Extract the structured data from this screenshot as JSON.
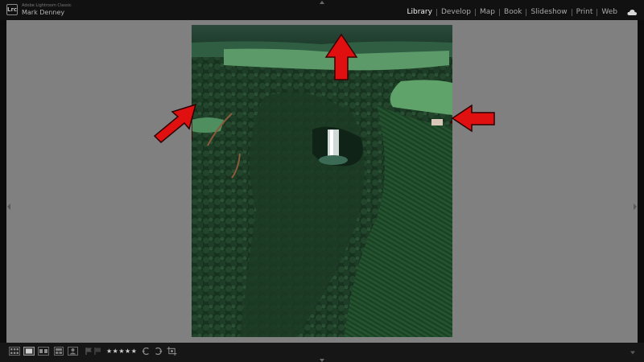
{
  "app": {
    "logo_text": "Lrc",
    "product_name": "Adobe Lightroom Classic",
    "user_name": "Mark Denney"
  },
  "modules": [
    {
      "label": "Library",
      "active": true
    },
    {
      "label": "Develop",
      "active": false
    },
    {
      "label": "Map",
      "active": false
    },
    {
      "label": "Book",
      "active": false
    },
    {
      "label": "Slideshow",
      "active": false
    },
    {
      "label": "Print",
      "active": false
    },
    {
      "label": "Web",
      "active": false
    }
  ],
  "toolbar": {
    "rating_stars": "★★★★★"
  },
  "icons": {
    "grid_view": "grid-view-icon",
    "loupe_view": "loupe-view-icon",
    "compare_view": "compare-view-icon",
    "survey_view": "survey-view-icon",
    "people_view": "people-view-icon",
    "flag": "flag-icon",
    "rotate_left": "rotate-left-icon",
    "rotate_right": "rotate-right-icon",
    "crop_overlay": "crop-overlay-icon",
    "cloud": "cloud-icon"
  },
  "colors": {
    "canvas_bg": "#808080",
    "topbar_bg": "#111111",
    "toolbar_bg": "#161616",
    "active_module": "#f0f0f0",
    "inactive_module": "#a9a9a9",
    "annotation_arrow": "#e01010"
  },
  "photo": {
    "subject": "aerial-forest-waterfall",
    "annotation_arrows": 3
  }
}
